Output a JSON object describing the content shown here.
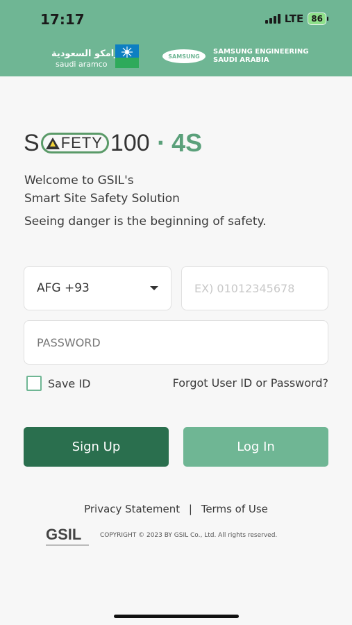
{
  "status_bar": {
    "time": "17:17",
    "network": "LTE",
    "battery": "86"
  },
  "partners": {
    "aramco_arabic": "أرامكو السعودية",
    "aramco_english": "saudi aramco",
    "samsung_logo": "SAMSUNG",
    "samsung_line1": "SAMSUNG ENGINEERING",
    "samsung_line2": "SAUDI ARABIA"
  },
  "app_logo": {
    "s": "S",
    "word": "FETY",
    "number": "100",
    "dot": "·",
    "suffix": "4S"
  },
  "welcome": {
    "line1": "Welcome to GSIL's",
    "line2": "Smart Site Safety Solution"
  },
  "tagline": "Seeing danger is the beginning of safety.",
  "form": {
    "country_code": "AFG +93",
    "phone_placeholder": "EX) 01012345678",
    "password_placeholder": "PASSWORD",
    "save_id_label": "Save ID",
    "forgot_label": "Forgot User ID or Password?"
  },
  "buttons": {
    "sign_up": "Sign Up",
    "log_in": "Log In"
  },
  "footer": {
    "privacy": "Privacy Statement",
    "separator": "|",
    "terms": "Terms of Use",
    "gsil_logo": "GSIL",
    "copyright": "COPYRIGHT © 2023 BY GSIL Co., Ltd. All rights reserved."
  },
  "colors": {
    "header": "#6fb694",
    "sign_up": "#2a6f4e",
    "log_in": "#6fb694",
    "accent": "#5aa07a"
  }
}
